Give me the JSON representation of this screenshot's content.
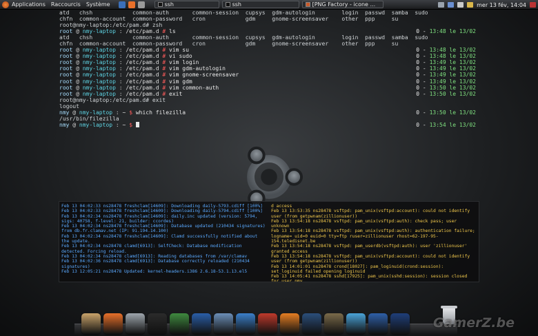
{
  "panel": {
    "menus": [
      "Applications",
      "Raccourcis",
      "Système"
    ],
    "tasks": [
      "ssh",
      "ssh",
      "[PNG Factory - icone ..."
    ],
    "clock": "mer 13 fév, 14:04"
  },
  "terminal": {
    "lines": [
      {
        "type": "plain",
        "text": "atd   chsh            common-auth       common-session  cupsys  gdm-autologin        login  passwd  samba  sudo"
      },
      {
        "type": "plain",
        "text": "chfn  common-account  common-password   cron            gdm     gnome-screensaver    other  ppp     su"
      },
      {
        "type": "plain",
        "text": "root@nmy-laptop:/etc/pam.d# zsh"
      },
      {
        "type": "prompt",
        "user": "root",
        "host": "nmy-laptop",
        "path": "/etc/pam.d",
        "sym": "#",
        "cmd": "ls",
        "status": "0",
        "time": "13:48 le 13/02"
      },
      {
        "type": "plain",
        "text": "atd   chsh            common-auth       common-session  cupsys  gdm-autologin        login  passwd  samba  sudo"
      },
      {
        "type": "plain",
        "text": "chfn  common-account  common-password   cron            gdm     gnome-screensaver    other  ppp     su"
      },
      {
        "type": "prompt",
        "user": "root",
        "host": "nmy-laptop",
        "path": "/etc/pam.d",
        "sym": "#",
        "cmd": "vim su",
        "status": "0",
        "time": "13:48 le 13/02"
      },
      {
        "type": "prompt",
        "user": "root",
        "host": "nmy-laptop",
        "path": "/etc/pam.d",
        "sym": "#",
        "cmd": "vi sudo",
        "status": "0",
        "time": "13:48 le 13/02"
      },
      {
        "type": "prompt",
        "user": "root",
        "host": "nmy-laptop",
        "path": "/etc/pam.d",
        "sym": "#",
        "cmd": "vim login",
        "status": "0",
        "time": "13:49 le 13/02"
      },
      {
        "type": "prompt",
        "user": "root",
        "host": "nmy-laptop",
        "path": "/etc/pam.d",
        "sym": "#",
        "cmd": "vim gdm-autologin",
        "status": "0",
        "time": "13:49 le 13/02"
      },
      {
        "type": "prompt",
        "user": "root",
        "host": "nmy-laptop",
        "path": "/etc/pam.d",
        "sym": "#",
        "cmd": "vim gnome-screensaver",
        "status": "0",
        "time": "13:49 le 13/02"
      },
      {
        "type": "prompt",
        "user": "root",
        "host": "nmy-laptop",
        "path": "/etc/pam.d",
        "sym": "#",
        "cmd": "vim gdm",
        "status": "0",
        "time": "13:49 le 13/02"
      },
      {
        "type": "prompt",
        "user": "root",
        "host": "nmy-laptop",
        "path": "/etc/pam.d",
        "sym": "#",
        "cmd": "vim common-auth",
        "status": "0",
        "time": "13:50 le 13/02"
      },
      {
        "type": "prompt",
        "user": "root",
        "host": "nmy-laptop",
        "path": "/etc/pam.d",
        "sym": "#",
        "cmd": "exit",
        "status": "0",
        "time": "13:50 le 13/02"
      },
      {
        "type": "plain",
        "text": "root@nmy-laptop:/etc/pam.d# exit"
      },
      {
        "type": "plain",
        "text": "logout"
      },
      {
        "type": "prompt",
        "user": "nmy",
        "host": "nmy-laptop",
        "path": "~",
        "sym": "$",
        "cmd": "which filezilla",
        "status": "0",
        "time": "13:50 le 13/02"
      },
      {
        "type": "plain",
        "text": "/usr/bin/filezilla"
      },
      {
        "type": "prompt",
        "user": "nmy",
        "host": "nmy-laptop",
        "path": "~",
        "sym": "$",
        "cmd": "",
        "status": "0",
        "time": "13:54 le 13/02",
        "cursor": true
      }
    ]
  },
  "logs": {
    "left": [
      "Feb 13 04:02:33 ns28478 freshclam[14609]: Downloading daily-5793.cdiff [100%]",
      "Feb 13 04:02:33 ns28478 freshclam[14609]: Downloading daily-5794.cdiff [100%]",
      "Feb 13 04:02:34 ns28478 freshclam[14609]: daily.inc updated (version: 5794, sigs: 40758, f-level: 21, builder: ccordes)",
      "Feb 13 04:02:34 ns28478 freshclam[14609]: Database updated (210434 signatures) from db.fr.clamav.net (IP: 91.194.14.100)",
      "Feb 13 04:02:34 ns28478 freshclam[14609]: Clamd successfully notified about the update.",
      "Feb 13 04:02:34 ns28478 clamd[6913]: SelfCheck: Database modification detected. Forcing reload.",
      "Feb 13 04:02:34 ns28478 clamd[6913]: Reading databases from /var/clamav",
      "Feb 13 04:02:36 ns28478 clamd[6913]: Database correctly reloaded (210434 signatures)",
      "Feb 13 12:05:21 ns28478 Updated: kernel-headers.i386 2.6.18-53.1.13.el5"
    ],
    "right": [
      "d access",
      "Feb 13 13:53:35 ns28478 vsftpd: pam_unix(vsftpd:account): could not identify user (from getpwnam(zillionuser))",
      "Feb 13 13:54:18 ns28478 vsftpd: pam_unix(vsftpd:auth): check pass; user unknown",
      "Feb 13 13:54:18 ns28478 vsftpd: pam_unix(vsftpd:auth): authentication failure; logname= uid=0 euid=0 tty=ftp ruser=zillionuser rhost=62-197-95-154.teledisnet.be",
      "Feb 13 13:54:18 ns28478 vsftpd: pam_userdb(vsftpd:auth): user 'zillionuser' granted access",
      "Feb 13 13:54:18 ns28478 vsftpd: pam_unix(vsftpd:account): could not identify user (from getpwnam(zillionuser))",
      "Feb 13 14:01:01 ns28478 crond[18027]: pam_loginuid(crond:session): set_loginuid failed opening loginuid",
      "Feb 13 14:05:41 ns28478 sshd[17925]: pam_unix(sshd:session): session closed for user nmy"
    ]
  },
  "dock": {
    "apps": [
      {
        "name": "notes",
        "color": "#c9a36a"
      },
      {
        "name": "firefox",
        "color": "#e8702a"
      },
      {
        "name": "mail",
        "color": "#9ea6ad"
      },
      {
        "name": "clapper",
        "color": "#2b2b2b"
      },
      {
        "name": "globe",
        "color": "#3f8a3f"
      },
      {
        "name": "lock",
        "color": "#2a5ea8"
      },
      {
        "name": "settings",
        "color": "#6b8fb8"
      },
      {
        "name": "people",
        "color": "#3b7fc9"
      },
      {
        "name": "filezilla",
        "color": "#c0392b"
      },
      {
        "name": "vlc",
        "color": "#e67e22"
      },
      {
        "name": "music",
        "color": "#2b4e7a"
      },
      {
        "name": "gimp",
        "color": "#7a6a4a"
      },
      {
        "name": "box",
        "color": "#4aa3d8"
      },
      {
        "name": "word",
        "color": "#2e5fa8"
      },
      {
        "name": "terminal",
        "color": "#1f3f7a"
      }
    ]
  },
  "watermark": "GamerZ.be"
}
